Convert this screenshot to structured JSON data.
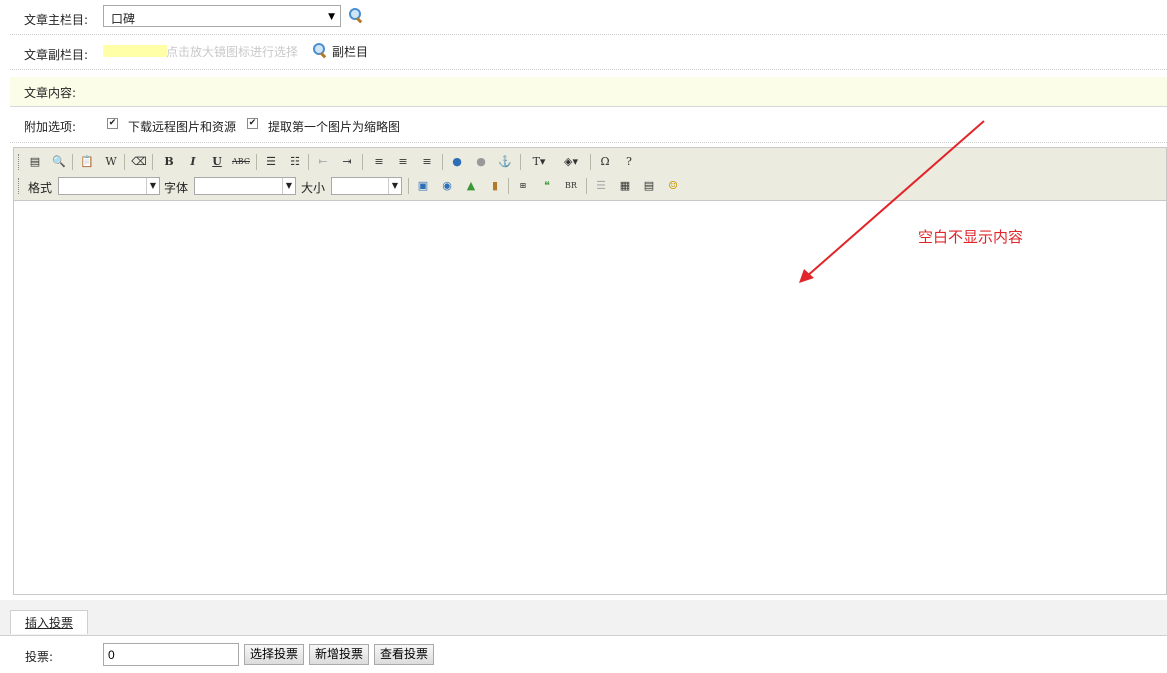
{
  "main_column": {
    "label": "文章主栏目:",
    "selected": "口碑"
  },
  "sub_column": {
    "label": "文章副栏目:",
    "hint": "点击放大镜图标进行选择",
    "link": "副栏目"
  },
  "content": {
    "label": "文章内容:"
  },
  "options": {
    "label": "附加选项:",
    "download_remote": "下载远程图片和资源",
    "first_image_thumb": "提取第一个图片为缩略图"
  },
  "toolbar": {
    "row1": [
      "source-icon",
      "preview-icon",
      "paste-icon",
      "paste-word-icon",
      "eraser-icon",
      "B",
      "I",
      "U",
      "ABC",
      "ordered-list-icon",
      "unordered-list-icon",
      "outdent-icon",
      "indent-icon",
      "align-left-icon",
      "align-center-icon",
      "align-right-icon",
      "link-icon",
      "unlink-icon",
      "anchor-icon",
      "text-color-icon",
      "bg-color-icon",
      "special-char-icon",
      "help-icon"
    ],
    "format_label": "格式",
    "font_label": "字体",
    "size_label": "大小"
  },
  "annotation": "空白不显示内容",
  "vote": {
    "tab": "插入投票",
    "label": "投票:",
    "value": "0",
    "select_btn": "选择投票",
    "new_btn": "新增投票",
    "view_btn": "查看投票"
  },
  "colors": {
    "annotation": "#e0262a",
    "toolbar_bg": "#ebebdf",
    "highlight_row": "#fcfde9"
  }
}
